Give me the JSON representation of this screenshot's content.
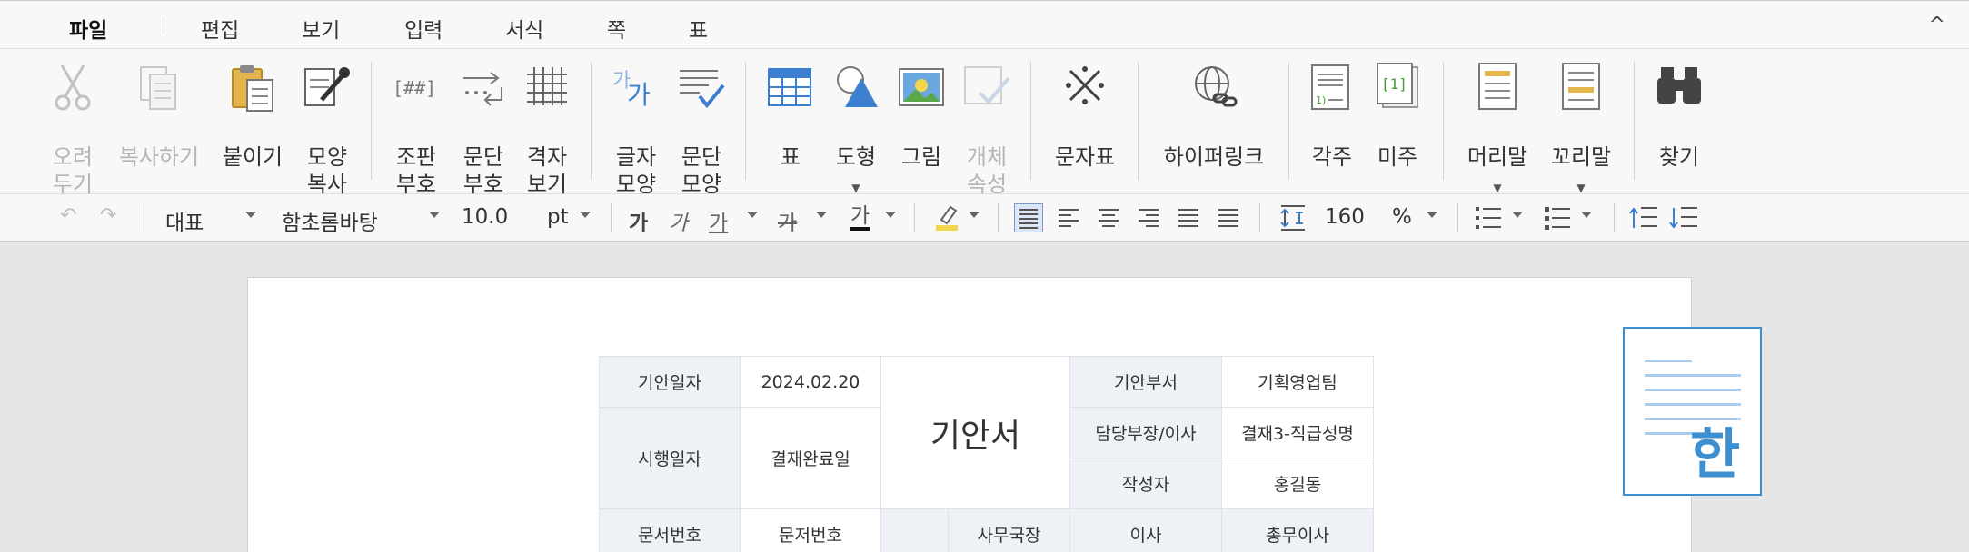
{
  "menu": {
    "items": [
      "파일",
      "편집",
      "보기",
      "입력",
      "서식",
      "쪽",
      "표"
    ],
    "active": "파일",
    "collapse_glyph": "^"
  },
  "ribbon": {
    "cut": "오려\n두기",
    "copy": "복사하기",
    "paste": "붙이기",
    "format_copy": "모양\n복사",
    "ruby": "조판\n부호",
    "para_mark": "문단\n부호",
    "grid": "격자\n보기",
    "char_shape": "글자\n모양",
    "para_shape": "문단\n모양",
    "table": "표",
    "shape": "도형",
    "image": "그림",
    "object_prop": "개체\n속성",
    "char_map": "문자표",
    "hyperlink": "하이퍼링크",
    "footnote": "각주",
    "endnote": "미주",
    "header": "머리말",
    "footer": "꼬리말",
    "find": "찾기",
    "colors": {
      "blue": "#3c7fd0",
      "gray": "#6b6b6b",
      "disabled": "#c2c2c2"
    }
  },
  "format": {
    "style": "대표",
    "font": "함초롬바탕",
    "size": "10.0",
    "size_unit": "pt",
    "bold": "가",
    "italic": "가",
    "underline": "가",
    "strike": "가",
    "font_color": "가",
    "line_spacing": "160",
    "line_spacing_unit": "%"
  },
  "doc": {
    "label_draft_date": "기안일자",
    "draft_date": "2024.02.20",
    "title": "기안서",
    "label_dept": "기안부서",
    "dept": "기획영업팀",
    "label_exec_date": "시행일자",
    "exec_date": "결재완료일",
    "label_manager": "담당부장/이사",
    "manager": "결재3-직급성명",
    "label_writer": "작성자",
    "writer": "홍길동",
    "label_doc_no": "문서번호",
    "doc_no": "문저번호",
    "approver_1": "사무국장",
    "approver_2": "이사",
    "approver_3": "총무이사"
  },
  "logo": {
    "glyph": "한",
    "color": "#3d8fd0"
  }
}
